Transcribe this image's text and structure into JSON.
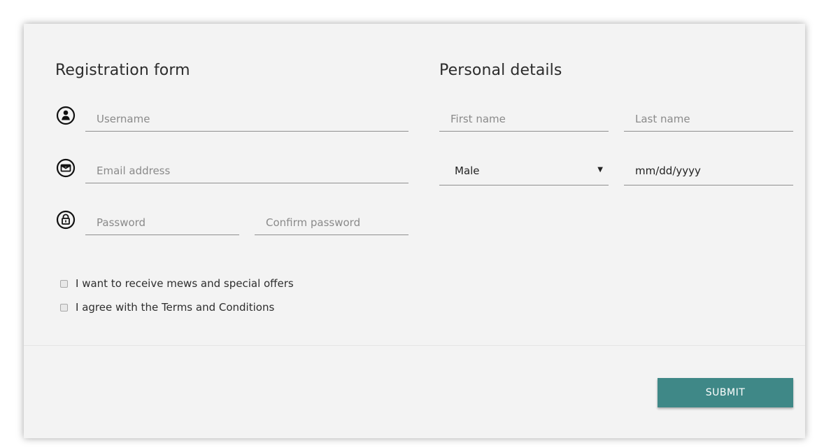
{
  "registration": {
    "title": "Registration form",
    "username_placeholder": "Username",
    "email_placeholder": "Email address",
    "password_placeholder": "Password",
    "confirm_password_placeholder": "Confirm password"
  },
  "personal": {
    "title": "Personal details",
    "first_name_placeholder": "First name",
    "last_name_placeholder": "Last name",
    "gender_selected": "Male",
    "date_placeholder": "mm/dd/yyyy"
  },
  "checkboxes": {
    "newsletter_label": "I want to receive mews and special offers",
    "terms_label": "I agree with the Terms and Conditions"
  },
  "submit_label": "SUBMIT",
  "icons": {
    "username": "user-icon",
    "email": "envelope-icon",
    "password": "lock-icon"
  },
  "colors": {
    "accent": "#3f8887",
    "card_background": "#f3f3f3"
  }
}
